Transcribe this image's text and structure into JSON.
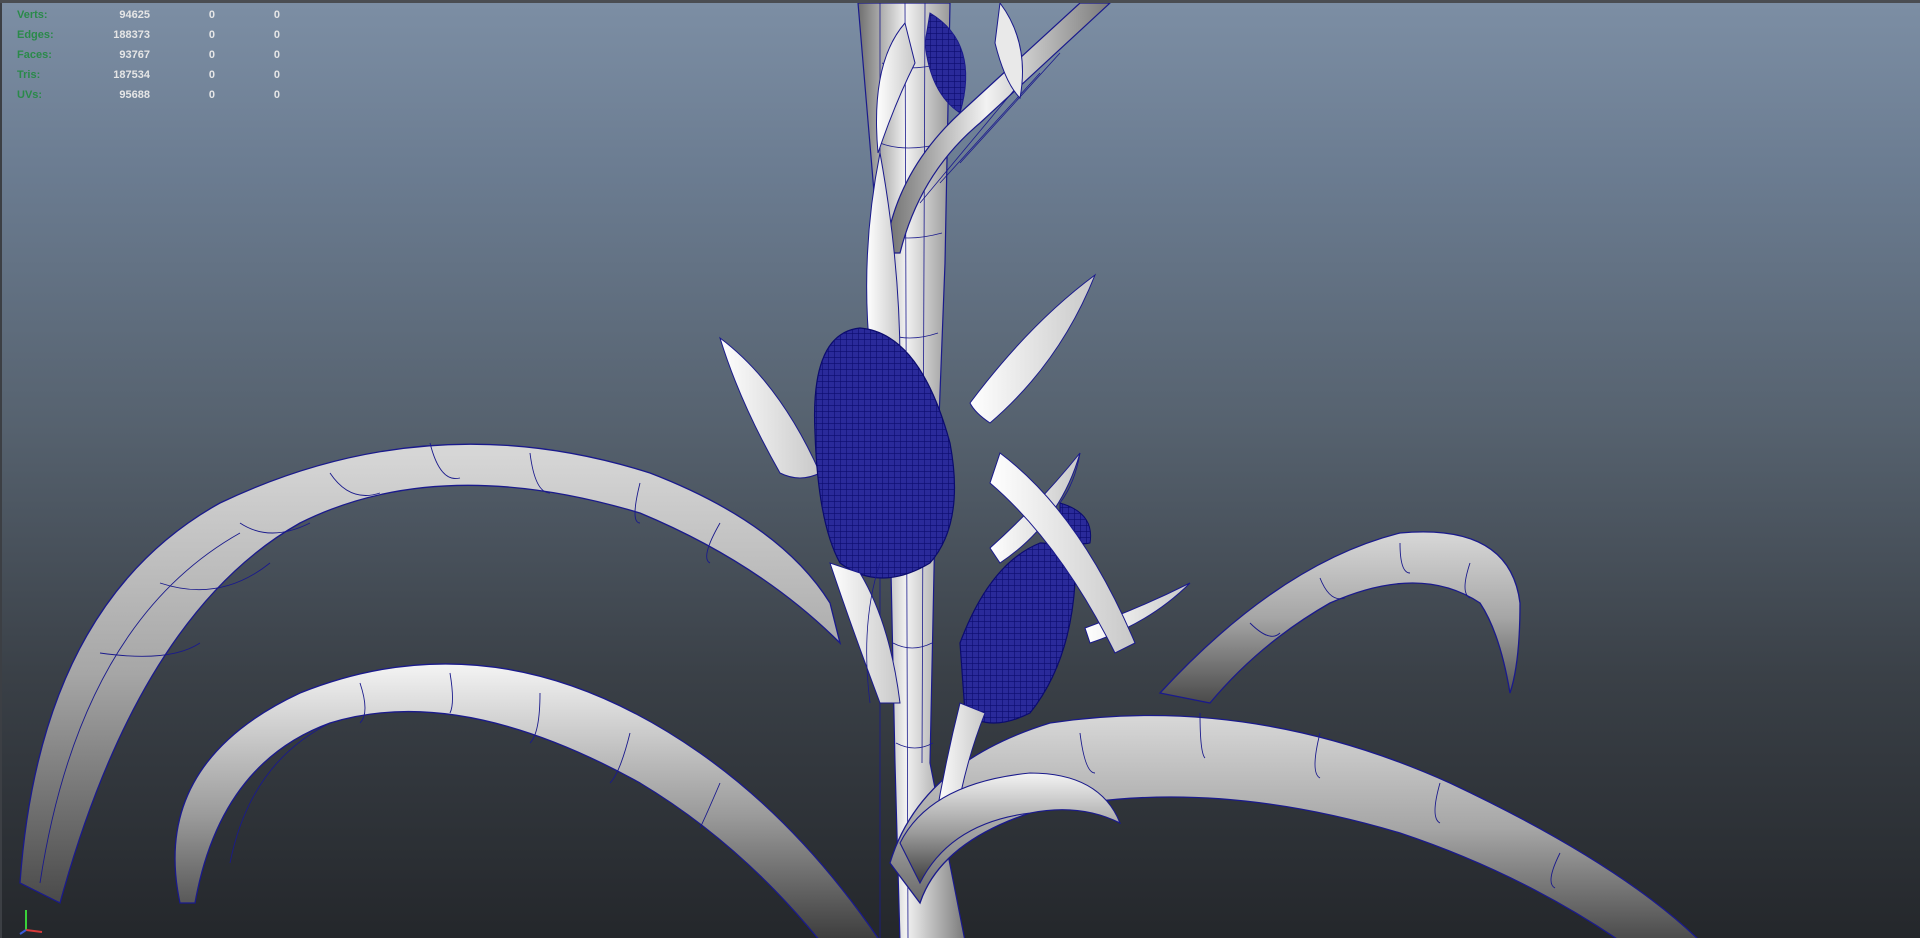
{
  "hud": {
    "rows": [
      {
        "label": "Verts:",
        "values": [
          "94625",
          "0",
          "0"
        ]
      },
      {
        "label": "Edges:",
        "values": [
          "188373",
          "0",
          "0"
        ]
      },
      {
        "label": "Faces:",
        "values": [
          "93767",
          "0",
          "0"
        ]
      },
      {
        "label": "Tris:",
        "values": [
          "187534",
          "0",
          "0"
        ]
      },
      {
        "label": "UVs:",
        "values": [
          "95688",
          "0",
          "0"
        ]
      }
    ],
    "label_color": "#2a8a4a",
    "value_color": "#e6e6e6"
  },
  "viewport": {
    "background_top": "#7c8ea4",
    "background_bottom": "#24272b",
    "wire_color": "#1a1a8c"
  }
}
